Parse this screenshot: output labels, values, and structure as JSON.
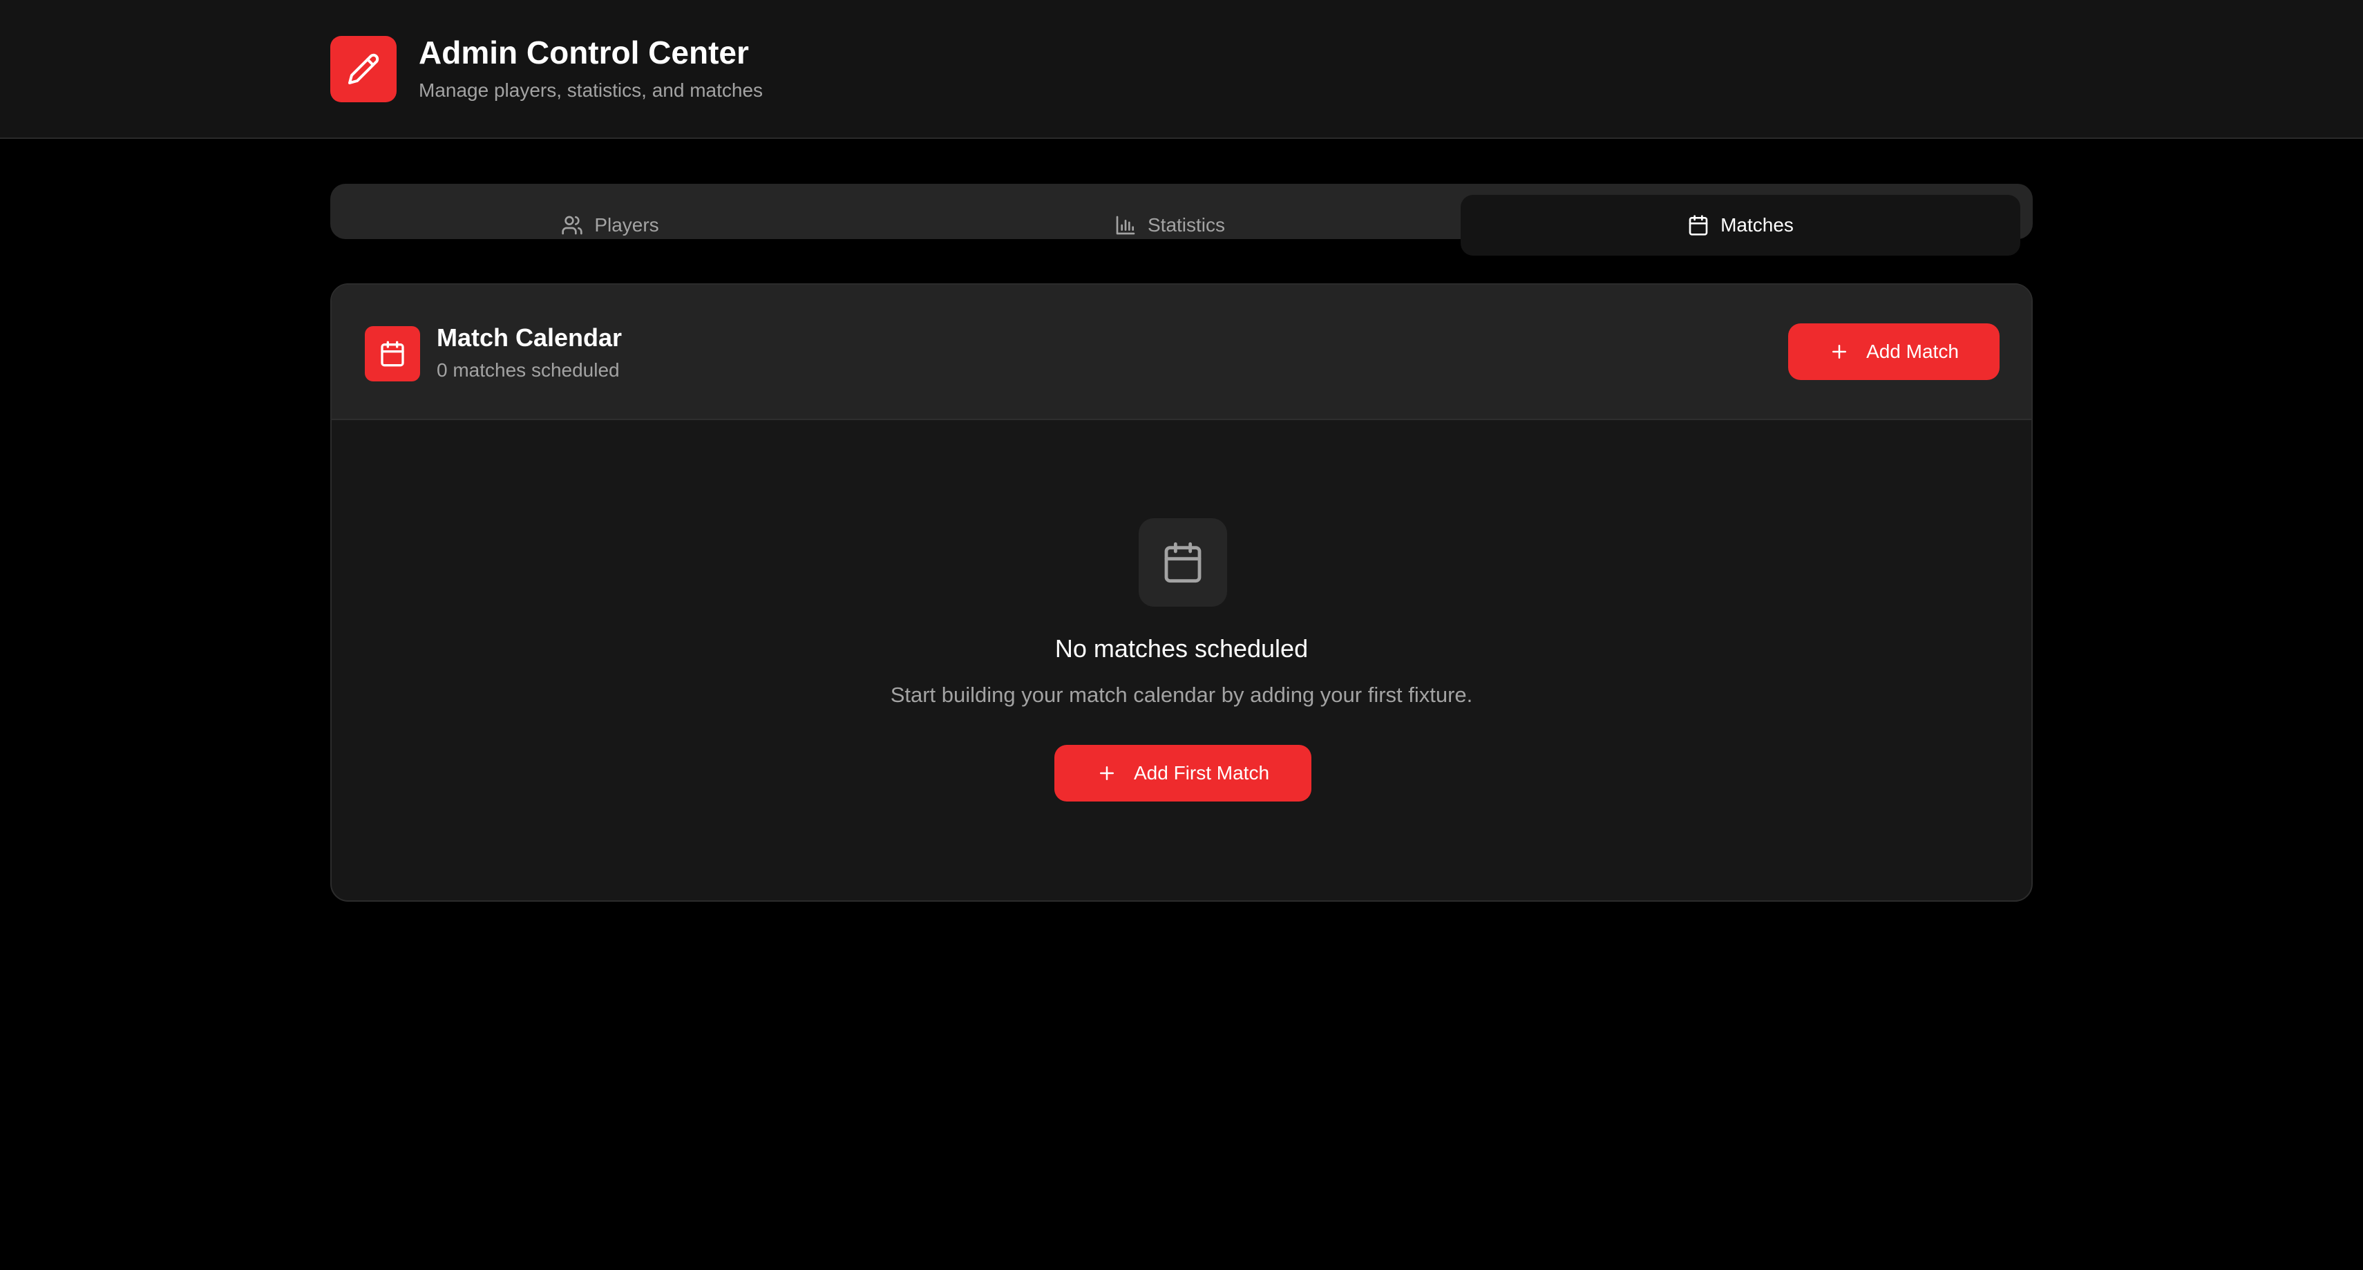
{
  "header": {
    "title": "Admin Control Center",
    "subtitle": "Manage players, statistics, and matches",
    "logo_icon": "pencil-icon"
  },
  "tabs": [
    {
      "label": "Players",
      "icon": "users-icon",
      "active": false
    },
    {
      "label": "Statistics",
      "icon": "bar-chart-icon",
      "active": false
    },
    {
      "label": "Matches",
      "icon": "calendar-icon",
      "active": true
    }
  ],
  "card": {
    "title": "Match Calendar",
    "subtitle": "0 matches scheduled",
    "icon": "calendar-icon",
    "add_button_label": "Add Match"
  },
  "empty_state": {
    "icon": "calendar-icon",
    "title": "No matches scheduled",
    "description": "Start building your match calendar by adding your first fixture.",
    "button_label": "Add First Match"
  },
  "colors": {
    "accent": "#ef2b2d",
    "background": "#000000",
    "surface": "#171717",
    "header": "#141414",
    "muted_text": "#a3a3a3"
  }
}
